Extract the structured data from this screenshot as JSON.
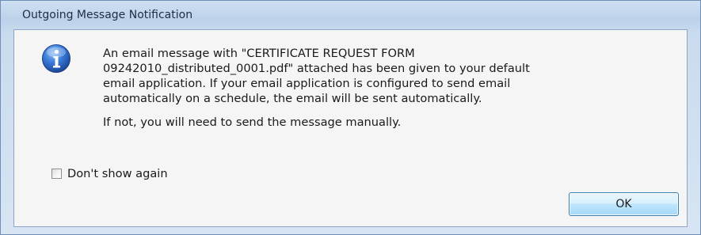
{
  "window": {
    "title": "Outgoing Message Notification"
  },
  "icon": {
    "name": "info-icon",
    "glyph": "i",
    "color": "#2c66c4"
  },
  "message": {
    "paragraph1_line1": "An email message with \"CERTIFICATE REQUEST FORM",
    "paragraph1_line2": "09242010_distributed_0001.pdf\" attached has been given to your default",
    "paragraph1_line3": "email application. If your email application is configured to send email",
    "paragraph1_line4": "automatically on a schedule, the email will be sent automatically.",
    "paragraph2": "If not, you will need to send the message manually."
  },
  "dont_show_again": {
    "label": "Don't show again",
    "checked": false
  },
  "buttons": {
    "ok_label": "OK"
  }
}
